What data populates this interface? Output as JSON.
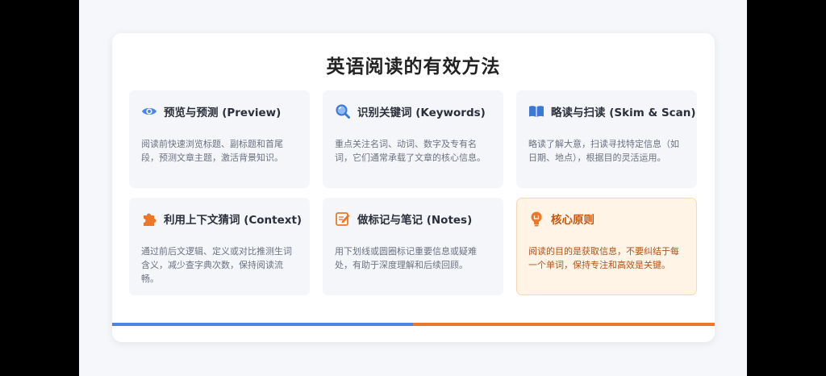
{
  "colors": {
    "accent_blue": "#4b86e6",
    "accent_orange": "#e9782c",
    "highlight_bg": "#fff4e6",
    "tile_bg": "#f5f6f9"
  },
  "title": "英语阅读的有效方法",
  "tiles": [
    {
      "icon": "eye-icon",
      "title": "预览与预测 (Preview)",
      "body": "阅读前快速浏览标题、副标题和首尾段，预测文章主题，激活背景知识。"
    },
    {
      "icon": "magnifier-icon",
      "title": "识别关键词 (Keywords)",
      "body": "重点关注名词、动词、数字及专有名词，它们通常承载了文章的核心信息。"
    },
    {
      "icon": "book-icon",
      "title": "略读与扫读 (Skim & Scan)",
      "body": "略读了解大意，扫读寻找特定信息（如日期、地点），根据目的灵活运用。"
    },
    {
      "icon": "puzzle-icon",
      "title": "利用上下文猜词 (Context)",
      "body": "通过前后文逻辑、定义或对比推测生词含义，减少查字典次数，保持阅读流畅。"
    },
    {
      "icon": "memo-icon",
      "title": "做标记与笔记 (Notes)",
      "body": "用下划线或圆圈标记重要信息或疑难处，有助于深度理解和后续回顾。"
    },
    {
      "icon": "lightbulb-icon",
      "title": "核心原则",
      "body": "阅读的目的是获取信息，不要纠结于每一个单词，保持专注和高效是关键。"
    }
  ]
}
